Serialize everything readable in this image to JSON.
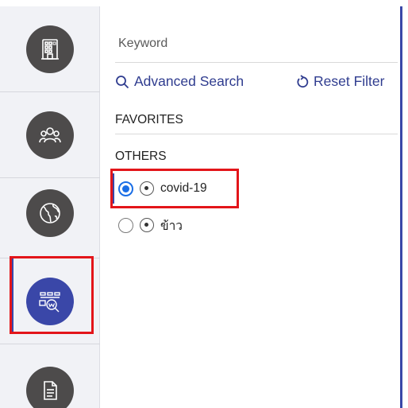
{
  "nav": {
    "items": [
      {
        "icon": "building-icon"
      },
      {
        "icon": "people-group-icon"
      },
      {
        "icon": "globe-icon"
      },
      {
        "icon": "web-monitor-icon",
        "active": true
      },
      {
        "icon": "document-icon"
      }
    ]
  },
  "search": {
    "keyword_placeholder": "Keyword",
    "advanced_label": "Advanced Search",
    "reset_label": "Reset Filter"
  },
  "sections": {
    "favorites_label": "FAVORITES",
    "others_label": "OTHERS"
  },
  "others_items": [
    {
      "label": "covid-19",
      "selected": true
    },
    {
      "label": "ข้าว",
      "selected": false
    }
  ],
  "colors": {
    "accent": "#3a47a8",
    "link": "#2f3c8f",
    "highlight": "#e3151a",
    "radio_checked": "#1a6ee6",
    "nav_icon_bg": "#4d4b4b"
  }
}
